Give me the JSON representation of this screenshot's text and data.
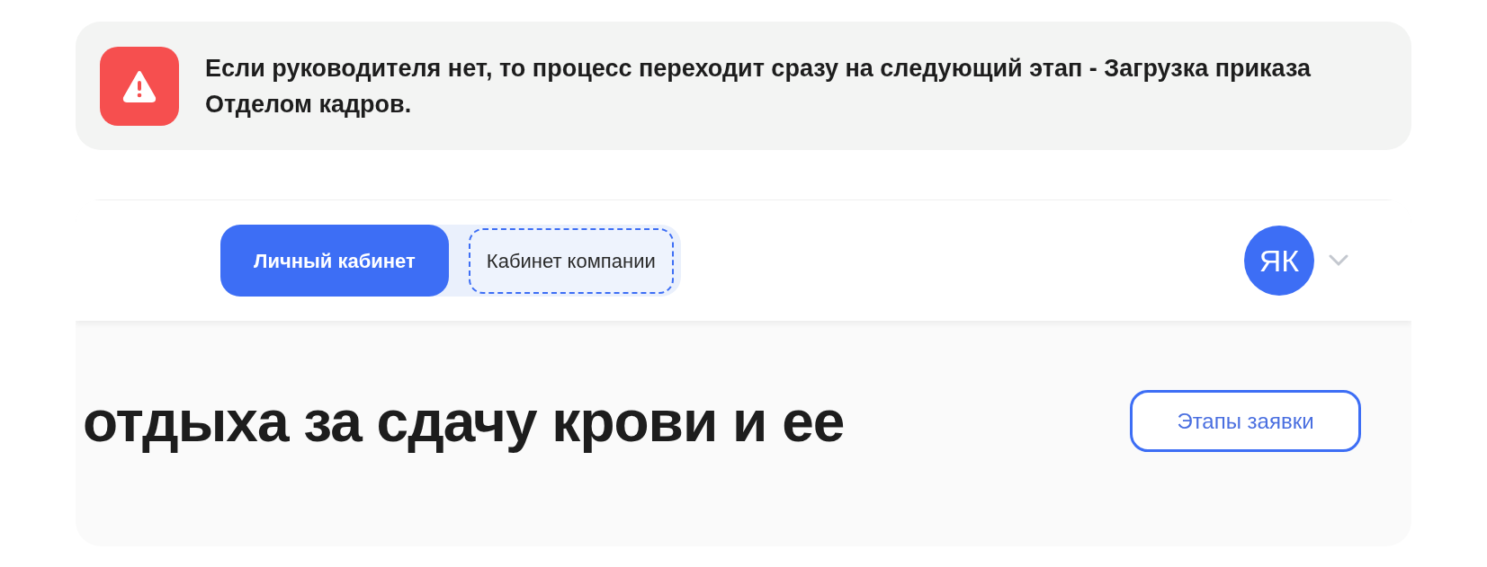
{
  "alert": {
    "kind": "warning",
    "text": "Если руководителя нет, то процесс переходит сразу на следующий этап - Загрузка приказа Отделом кадров."
  },
  "header": {
    "tabs": [
      {
        "label": "Личный кабинет",
        "selected": true,
        "focused": false
      },
      {
        "label": "Кабинет компании",
        "selected": false,
        "focused": true
      }
    ],
    "avatar": {
      "initials": "ЯК"
    }
  },
  "page": {
    "heading": "отдыха за сдачу крови и ее",
    "button": "Этапы заявки"
  }
}
